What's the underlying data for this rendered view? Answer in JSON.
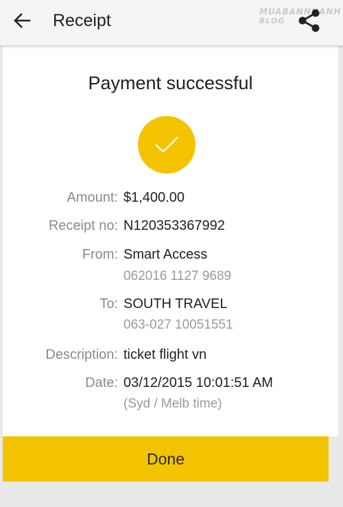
{
  "appbar": {
    "title": "Receipt",
    "back_icon": "arrow-left-icon",
    "share_icon": "share-icon",
    "watermark_line1": "MUABANNHANH",
    "watermark_line2": "BLOG"
  },
  "receipt": {
    "heading": "Payment successful",
    "status_icon": "checkmark-icon",
    "accent_color": "#f4c300",
    "fields": {
      "amount_label": "Amount:",
      "amount_value": "$1,400.00",
      "receipt_no_label": "Receipt no:",
      "receipt_no_value": "N120353367992",
      "from_label": "From:",
      "from_value": "Smart Access",
      "from_account": "062016 1127 9689",
      "to_label": "To:",
      "to_value": "SOUTH TRAVEL",
      "to_account": "063-027 10051551",
      "description_label": "Description:",
      "description_value": "ticket flight vn",
      "date_label": "Date:",
      "date_value": "03/12/2015 10:01:51 AM",
      "date_note": "(Syd / Melb time)"
    }
  },
  "actions": {
    "done_label": "Done"
  }
}
